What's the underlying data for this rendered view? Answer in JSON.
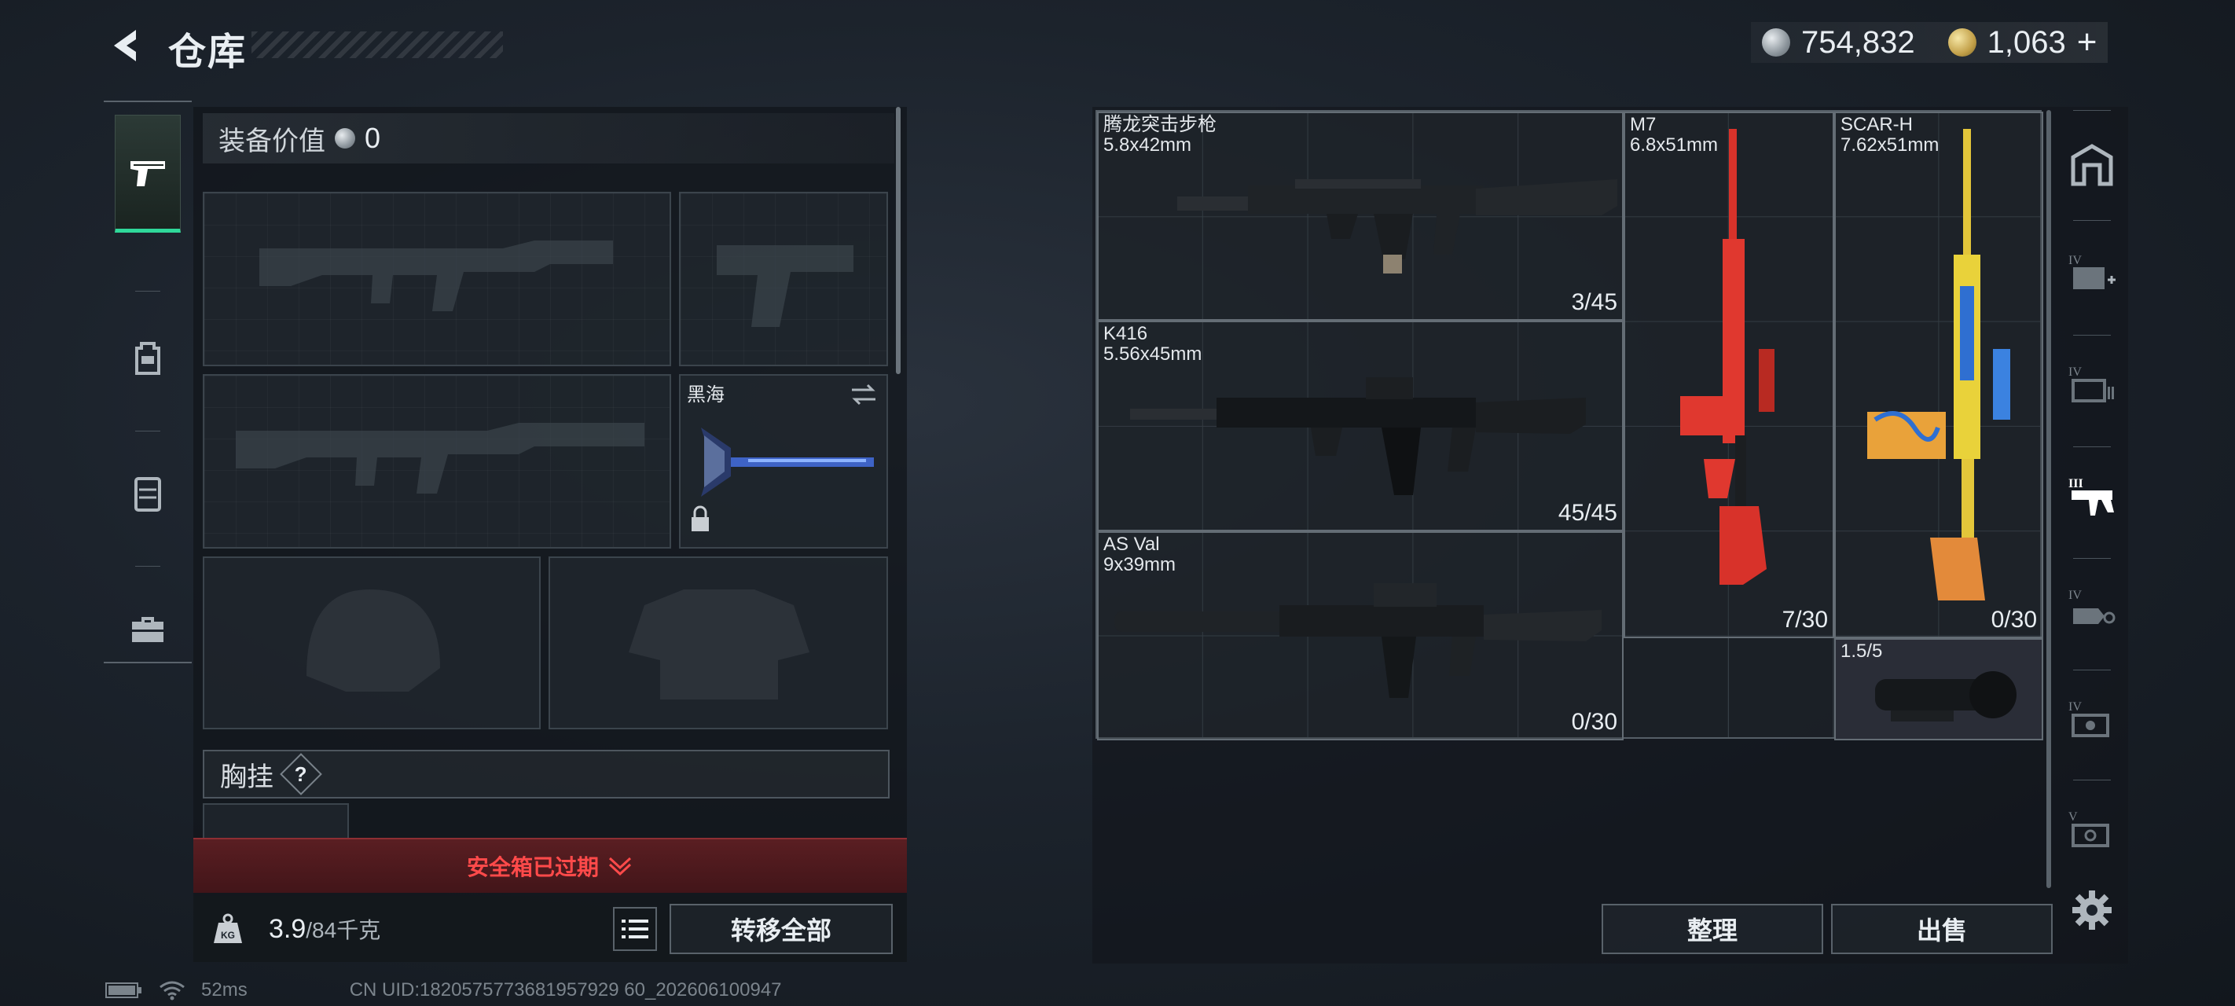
{
  "header": {
    "title": "仓库",
    "currency_silver": "754,832",
    "currency_gold": "1,063"
  },
  "left_tabs": [
    {
      "name": "weapons",
      "icon": "pistol-icon",
      "active": true
    },
    {
      "name": "gear",
      "icon": "backpack-icon",
      "active": false
    },
    {
      "name": "vest",
      "icon": "vest-icon",
      "active": false
    },
    {
      "name": "case",
      "icon": "toolbox-icon",
      "active": false
    }
  ],
  "loadout": {
    "value_label": "装备价值",
    "value": "0",
    "melee_name": "黑海",
    "chest_label": "胸挂",
    "chest_help": "?",
    "expired_label": "安全箱已过期",
    "weight_value": "3.9",
    "weight_cap": "/84千克",
    "transfer_all_label": "转移全部"
  },
  "status": {
    "ping": "52ms",
    "uid": "CN UID:1820575773681957929 60_202606100947"
  },
  "stash_items": [
    {
      "name": "腾龙突击步枪",
      "caliber": "5.8x42mm",
      "ammo": "3/45",
      "color": "#1c1f22"
    },
    {
      "name": "K416",
      "caliber": "5.56x45mm",
      "ammo": "45/45",
      "color": "#15181b"
    },
    {
      "name": "AS Val",
      "caliber": "9x39mm",
      "ammo": "0/30",
      "color": "#1a1d20"
    },
    {
      "name": "M7",
      "caliber": "6.8x51mm",
      "ammo": "7/30",
      "color": "#e0382f"
    },
    {
      "name": "SCAR-H",
      "caliber": "7.62x51mm",
      "ammo": "0/30",
      "color": "#e9d23a"
    },
    {
      "name": "1.5/5",
      "caliber": "",
      "ammo": "",
      "color": "#2a2d33"
    }
  ],
  "stash_actions": {
    "sort_label": "整理",
    "sell_label": "出售"
  },
  "category_rail": [
    {
      "icon": "storage-icon"
    },
    {
      "icon": "stash-tab-iv-add-icon",
      "tier": "IV"
    },
    {
      "icon": "stash-tab-iv-ammo-icon",
      "tier": "IV"
    },
    {
      "icon": "stash-tab-iii-weapons-icon",
      "tier": "III",
      "active": true
    },
    {
      "icon": "stash-tab-iv-tools-icon",
      "tier": "IV"
    },
    {
      "icon": "stash-tab-iv-parts-icon",
      "tier": "IV"
    },
    {
      "icon": "stash-tab-v-misc-icon",
      "tier": "V"
    }
  ]
}
